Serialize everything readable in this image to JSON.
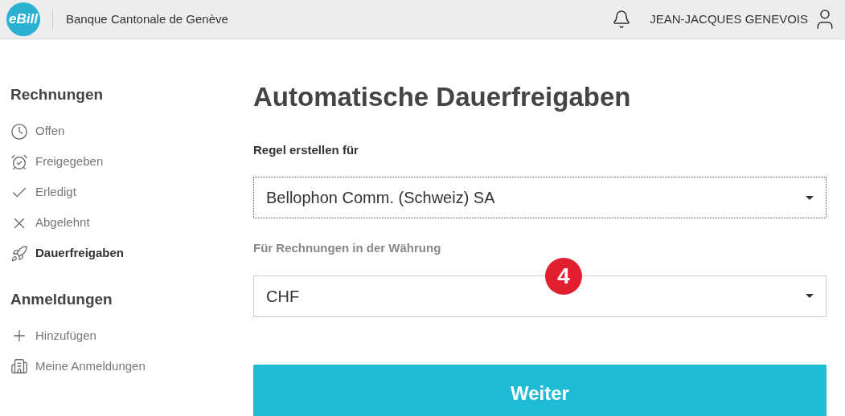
{
  "header": {
    "logo": "eBill",
    "bank": "Banque Cantonale de Genève",
    "user": "JEAN-JACQUES GENEVOIS"
  },
  "sidebar": [
    {
      "heading": "Rechnungen",
      "items": [
        {
          "label": "Offen",
          "selected": false
        },
        {
          "label": "Freigegeben",
          "selected": false
        },
        {
          "label": "Erledigt",
          "selected": false
        },
        {
          "label": "Abgelehnt",
          "selected": false
        },
        {
          "label": "Dauerfreigaben",
          "selected": true
        }
      ]
    },
    {
      "heading": "Anmeldungen",
      "items": [
        {
          "label": "Hinzufügen",
          "selected": false
        },
        {
          "label": "Meine Anmeldungen",
          "selected": false
        }
      ]
    }
  ],
  "main": {
    "title": "Automatische Dauerfreigaben",
    "fields": [
      {
        "label": "Regel erstellen für",
        "value": "Bellophon Comm. (Schweiz) SA",
        "focused": true
      },
      {
        "label": "Für Rechnungen in der Währung",
        "value": "CHF",
        "focused": false
      }
    ],
    "step_badge": "4",
    "button": "Weiter"
  }
}
